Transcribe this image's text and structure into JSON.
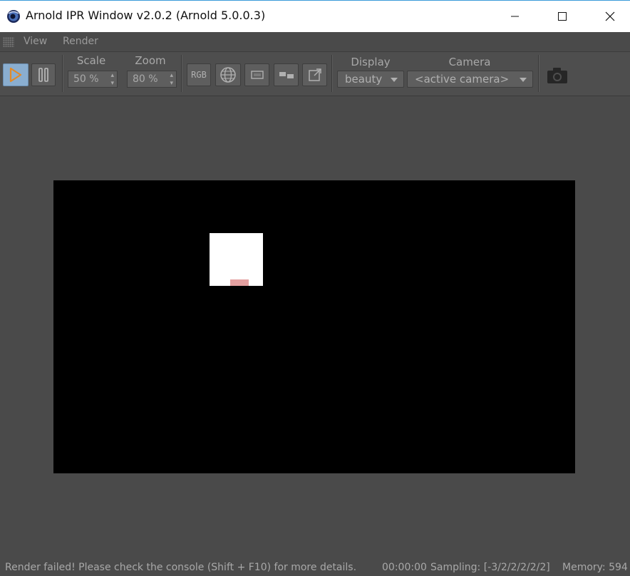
{
  "window": {
    "title": "Arnold IPR Window v2.0.2 (Arnold 5.0.0.3)",
    "app_icon": "cinema4d-icon"
  },
  "menu": {
    "items": [
      "View",
      "Render"
    ]
  },
  "toolbar": {
    "play_icon": "play-icon",
    "pause_icon": "pause-icon",
    "scale": {
      "label": "Scale",
      "value": "50 %"
    },
    "zoom": {
      "label": "Zoom",
      "value": "80 %"
    },
    "rgb_label": "RGB",
    "display": {
      "label": "Display",
      "value": "beauty"
    },
    "camera": {
      "label": "Camera",
      "value": "<active camera>"
    },
    "accent_color": "#8aaed0",
    "play_color": "#e08a2a"
  },
  "status": {
    "message": "Render failed! Please check the console (Shift + F10) for more details.",
    "time": "00:00:00",
    "sampling": "Sampling: [-3/2/2/2/2/2]",
    "memory": "Memory: 594"
  }
}
